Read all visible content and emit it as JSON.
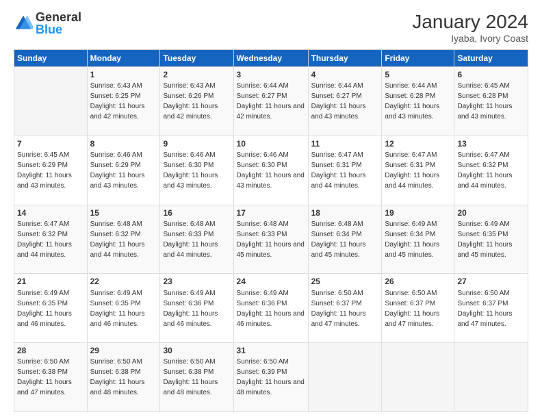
{
  "header": {
    "title": "January 2024",
    "subtitle": "Iyaba, Ivory Coast",
    "logo_line1": "General",
    "logo_line2": "Blue"
  },
  "days_of_week": [
    "Sunday",
    "Monday",
    "Tuesday",
    "Wednesday",
    "Thursday",
    "Friday",
    "Saturday"
  ],
  "weeks": [
    [
      {
        "day": "",
        "sunrise": "",
        "sunset": "",
        "daylight": "",
        "empty": true
      },
      {
        "day": "1",
        "sunrise": "Sunrise: 6:43 AM",
        "sunset": "Sunset: 6:25 PM",
        "daylight": "Daylight: 11 hours and 42 minutes."
      },
      {
        "day": "2",
        "sunrise": "Sunrise: 6:43 AM",
        "sunset": "Sunset: 6:26 PM",
        "daylight": "Daylight: 11 hours and 42 minutes."
      },
      {
        "day": "3",
        "sunrise": "Sunrise: 6:44 AM",
        "sunset": "Sunset: 6:27 PM",
        "daylight": "Daylight: 11 hours and 42 minutes."
      },
      {
        "day": "4",
        "sunrise": "Sunrise: 6:44 AM",
        "sunset": "Sunset: 6:27 PM",
        "daylight": "Daylight: 11 hours and 43 minutes."
      },
      {
        "day": "5",
        "sunrise": "Sunrise: 6:44 AM",
        "sunset": "Sunset: 6:28 PM",
        "daylight": "Daylight: 11 hours and 43 minutes."
      },
      {
        "day": "6",
        "sunrise": "Sunrise: 6:45 AM",
        "sunset": "Sunset: 6:28 PM",
        "daylight": "Daylight: 11 hours and 43 minutes."
      }
    ],
    [
      {
        "day": "7",
        "sunrise": "Sunrise: 6:45 AM",
        "sunset": "Sunset: 6:29 PM",
        "daylight": "Daylight: 11 hours and 43 minutes."
      },
      {
        "day": "8",
        "sunrise": "Sunrise: 6:46 AM",
        "sunset": "Sunset: 6:29 PM",
        "daylight": "Daylight: 11 hours and 43 minutes."
      },
      {
        "day": "9",
        "sunrise": "Sunrise: 6:46 AM",
        "sunset": "Sunset: 6:30 PM",
        "daylight": "Daylight: 11 hours and 43 minutes."
      },
      {
        "day": "10",
        "sunrise": "Sunrise: 6:46 AM",
        "sunset": "Sunset: 6:30 PM",
        "daylight": "Daylight: 11 hours and 43 minutes."
      },
      {
        "day": "11",
        "sunrise": "Sunrise: 6:47 AM",
        "sunset": "Sunset: 6:31 PM",
        "daylight": "Daylight: 11 hours and 44 minutes."
      },
      {
        "day": "12",
        "sunrise": "Sunrise: 6:47 AM",
        "sunset": "Sunset: 6:31 PM",
        "daylight": "Daylight: 11 hours and 44 minutes."
      },
      {
        "day": "13",
        "sunrise": "Sunrise: 6:47 AM",
        "sunset": "Sunset: 6:32 PM",
        "daylight": "Daylight: 11 hours and 44 minutes."
      }
    ],
    [
      {
        "day": "14",
        "sunrise": "Sunrise: 6:47 AM",
        "sunset": "Sunset: 6:32 PM",
        "daylight": "Daylight: 11 hours and 44 minutes."
      },
      {
        "day": "15",
        "sunrise": "Sunrise: 6:48 AM",
        "sunset": "Sunset: 6:32 PM",
        "daylight": "Daylight: 11 hours and 44 minutes."
      },
      {
        "day": "16",
        "sunrise": "Sunrise: 6:48 AM",
        "sunset": "Sunset: 6:33 PM",
        "daylight": "Daylight: 11 hours and 44 minutes."
      },
      {
        "day": "17",
        "sunrise": "Sunrise: 6:48 AM",
        "sunset": "Sunset: 6:33 PM",
        "daylight": "Daylight: 11 hours and 45 minutes."
      },
      {
        "day": "18",
        "sunrise": "Sunrise: 6:48 AM",
        "sunset": "Sunset: 6:34 PM",
        "daylight": "Daylight: 11 hours and 45 minutes."
      },
      {
        "day": "19",
        "sunrise": "Sunrise: 6:49 AM",
        "sunset": "Sunset: 6:34 PM",
        "daylight": "Daylight: 11 hours and 45 minutes."
      },
      {
        "day": "20",
        "sunrise": "Sunrise: 6:49 AM",
        "sunset": "Sunset: 6:35 PM",
        "daylight": "Daylight: 11 hours and 45 minutes."
      }
    ],
    [
      {
        "day": "21",
        "sunrise": "Sunrise: 6:49 AM",
        "sunset": "Sunset: 6:35 PM",
        "daylight": "Daylight: 11 hours and 46 minutes."
      },
      {
        "day": "22",
        "sunrise": "Sunrise: 6:49 AM",
        "sunset": "Sunset: 6:35 PM",
        "daylight": "Daylight: 11 hours and 46 minutes."
      },
      {
        "day": "23",
        "sunrise": "Sunrise: 6:49 AM",
        "sunset": "Sunset: 6:36 PM",
        "daylight": "Daylight: 11 hours and 46 minutes."
      },
      {
        "day": "24",
        "sunrise": "Sunrise: 6:49 AM",
        "sunset": "Sunset: 6:36 PM",
        "daylight": "Daylight: 11 hours and 46 minutes."
      },
      {
        "day": "25",
        "sunrise": "Sunrise: 6:50 AM",
        "sunset": "Sunset: 6:37 PM",
        "daylight": "Daylight: 11 hours and 47 minutes."
      },
      {
        "day": "26",
        "sunrise": "Sunrise: 6:50 AM",
        "sunset": "Sunset: 6:37 PM",
        "daylight": "Daylight: 11 hours and 47 minutes."
      },
      {
        "day": "27",
        "sunrise": "Sunrise: 6:50 AM",
        "sunset": "Sunset: 6:37 PM",
        "daylight": "Daylight: 11 hours and 47 minutes."
      }
    ],
    [
      {
        "day": "28",
        "sunrise": "Sunrise: 6:50 AM",
        "sunset": "Sunset: 6:38 PM",
        "daylight": "Daylight: 11 hours and 47 minutes."
      },
      {
        "day": "29",
        "sunrise": "Sunrise: 6:50 AM",
        "sunset": "Sunset: 6:38 PM",
        "daylight": "Daylight: 11 hours and 48 minutes."
      },
      {
        "day": "30",
        "sunrise": "Sunrise: 6:50 AM",
        "sunset": "Sunset: 6:38 PM",
        "daylight": "Daylight: 11 hours and 48 minutes."
      },
      {
        "day": "31",
        "sunrise": "Sunrise: 6:50 AM",
        "sunset": "Sunset: 6:39 PM",
        "daylight": "Daylight: 11 hours and 48 minutes."
      },
      {
        "day": "",
        "sunrise": "",
        "sunset": "",
        "daylight": "",
        "empty": true
      },
      {
        "day": "",
        "sunrise": "",
        "sunset": "",
        "daylight": "",
        "empty": true
      },
      {
        "day": "",
        "sunrise": "",
        "sunset": "",
        "daylight": "",
        "empty": true
      }
    ]
  ]
}
